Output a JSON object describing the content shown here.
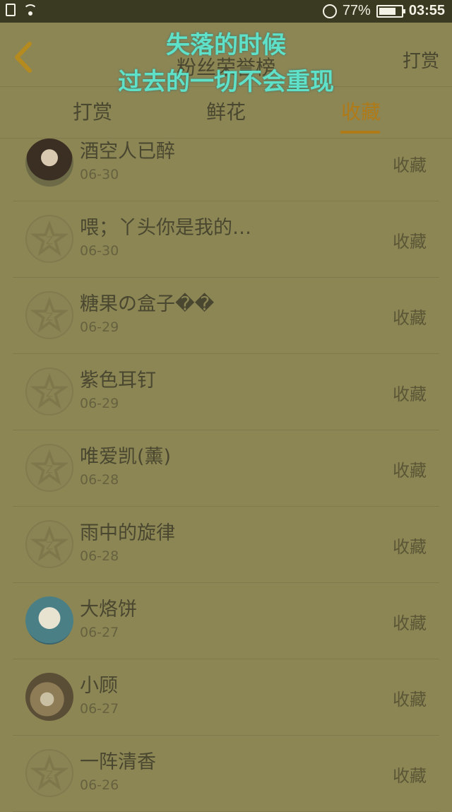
{
  "status_bar": {
    "battery": "77%",
    "battery_level": 0.77,
    "time": "03:55"
  },
  "header": {
    "title": "粉丝荣誉榜",
    "reward_link": "打赏"
  },
  "overlay_lyrics": {
    "line1": "失落的时候",
    "line2": "过去的一切不会重现"
  },
  "tabs": [
    {
      "label": "打赏"
    },
    {
      "label": "鲜花"
    },
    {
      "label": "收藏",
      "active": true
    }
  ],
  "list": [
    {
      "name": "酒空人已醉",
      "date": "06-30",
      "action": "收藏",
      "avatar": "photo-girl"
    },
    {
      "name": "喂；丫头你是我的…",
      "date": "06-30",
      "action": "收藏",
      "avatar": "default"
    },
    {
      "name": "糖果の盒子��",
      "date": "06-29",
      "action": "收藏",
      "avatar": "default"
    },
    {
      "name": "紫色耳钉",
      "date": "06-29",
      "action": "收藏",
      "avatar": "default"
    },
    {
      "name": "唯爱凯(薰)",
      "date": "06-28",
      "action": "收藏",
      "avatar": "default"
    },
    {
      "name": "雨中的旋律",
      "date": "06-28",
      "action": "收藏",
      "avatar": "default"
    },
    {
      "name": "大烙饼",
      "date": "06-27",
      "action": "收藏",
      "avatar": "illustration"
    },
    {
      "name": "小顾",
      "date": "06-27",
      "action": "收藏",
      "avatar": "photo-cup"
    },
    {
      "name": "一阵清香",
      "date": "06-26",
      "action": "收藏",
      "avatar": "default"
    }
  ]
}
